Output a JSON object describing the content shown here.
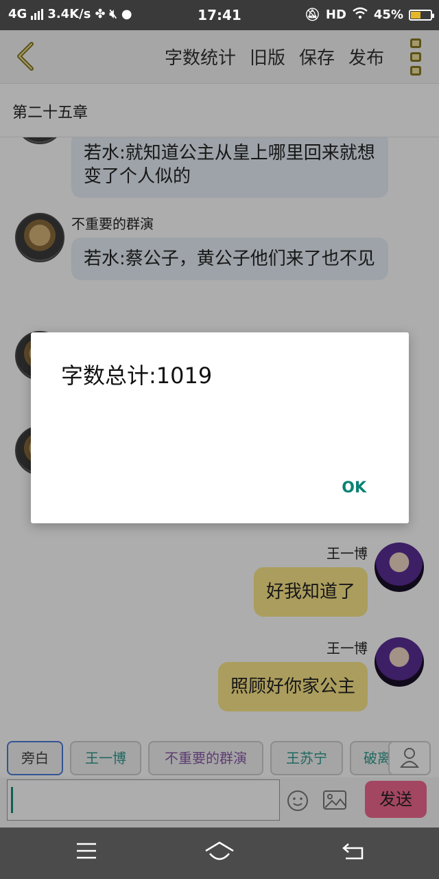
{
  "status_bar": {
    "network": "4G",
    "speed": "3.4K/s",
    "time": "17:41",
    "hd": "HD",
    "battery": "45%"
  },
  "header": {
    "actions": [
      "字数统计",
      "旧版",
      "保存",
      "发布"
    ]
  },
  "chapter": {
    "title": "第二十五章"
  },
  "messages": [
    {
      "side": "left",
      "name": "",
      "text": "若水:就知道公主从皇上哪里回来就想变了个人似的"
    },
    {
      "side": "left",
      "name": "不重要的群演",
      "text": "若水:蔡公子，黄公子他们来了也不见"
    },
    {
      "side": "right",
      "name": "王一博",
      "text": "好我知道了"
    },
    {
      "side": "right",
      "name": "王一博",
      "text": "照顾好你家公主"
    }
  ],
  "dialog": {
    "title": "字数总计:1019",
    "ok": "OK"
  },
  "chips": [
    {
      "label": "旁白",
      "color": "#555555"
    },
    {
      "label": "王一博",
      "color": "#2e9a8c"
    },
    {
      "label": "不重要的群演",
      "color": "#8a5aa8"
    },
    {
      "label": "王苏宁",
      "color": "#2e9a8c"
    },
    {
      "label": "破离",
      "color": "#2e9a8c"
    }
  ],
  "input": {
    "value": "",
    "send_label": "发送"
  },
  "colors": {
    "accent_teal": "#0a8275",
    "send_pink": "#f0688f",
    "bubble_yellow": "#fde88a",
    "bubble_blue": "#e8f0f8"
  }
}
